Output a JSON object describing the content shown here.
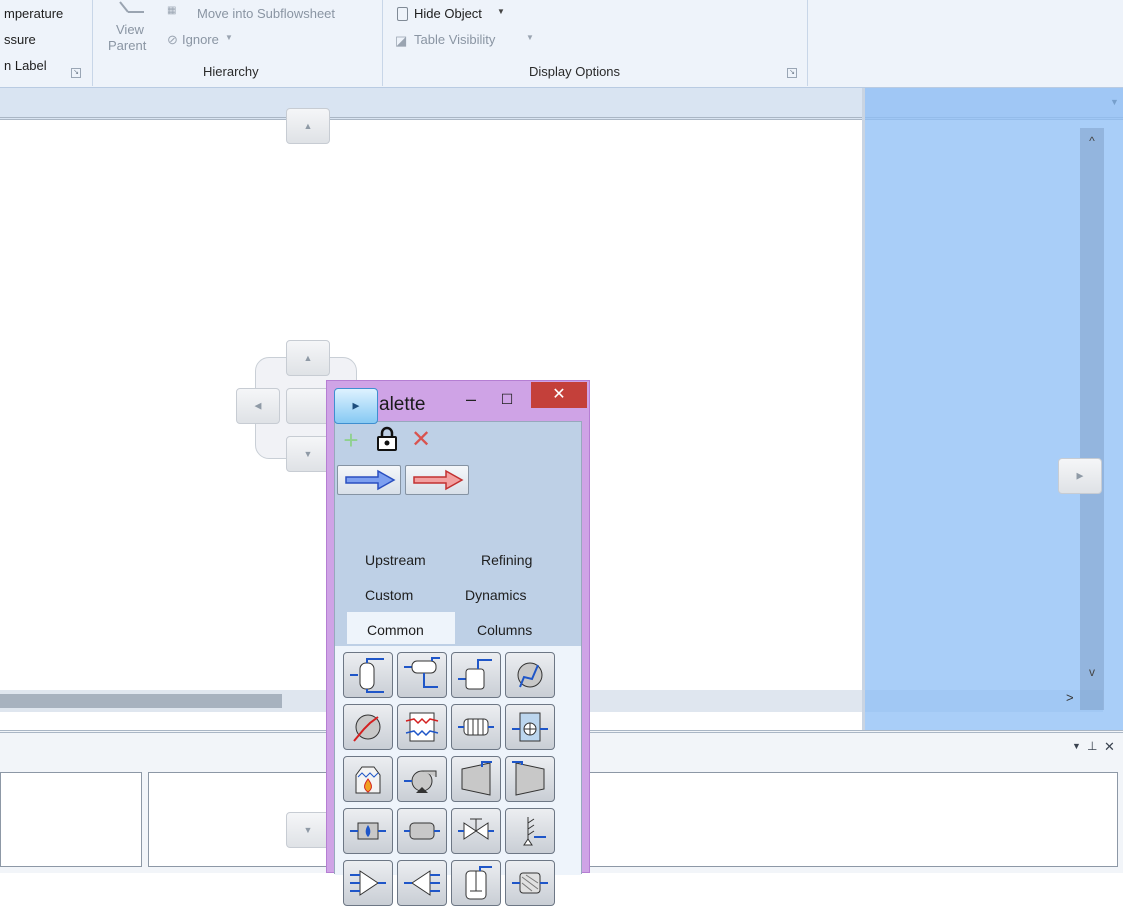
{
  "ribbon": {
    "left_labels": [
      "mperature",
      "ssure",
      "n Label"
    ],
    "view_parent": [
      "View",
      "Parent"
    ],
    "move_into_subflowsheet": "Move into Subflowsheet",
    "ignore": "Ignore",
    "hide_object": "Hide Object",
    "table_visibility": "Table Visibility",
    "group_hierarchy": "Hierarchy",
    "group_display_options": "Display Options"
  },
  "palette": {
    "title": "alette",
    "tabs": [
      "Upstream",
      "Refining",
      "Custom",
      "Dynamics",
      "Common",
      "Columns"
    ],
    "active_tab": "Common",
    "icons": [
      "separator-icon",
      "three-phase-separator-icon",
      "tank-icon",
      "heater-icon",
      "cooler-icon",
      "heat-exchanger-icon",
      "lng-exchanger-icon",
      "air-cooler-icon",
      "fired-heater-icon",
      "pump-icon",
      "compressor-icon",
      "expander-icon",
      "heater-block-icon",
      "pipe-segment-icon",
      "valve-icon",
      "relief-valve-icon",
      "mixer-icon",
      "tee-icon",
      "reactor-icon",
      "filter-icon"
    ]
  },
  "colors": {
    "palette_frame": "#cfa3e6",
    "dock_highlight": "#8cbef5",
    "close_button": "#c4403a"
  }
}
